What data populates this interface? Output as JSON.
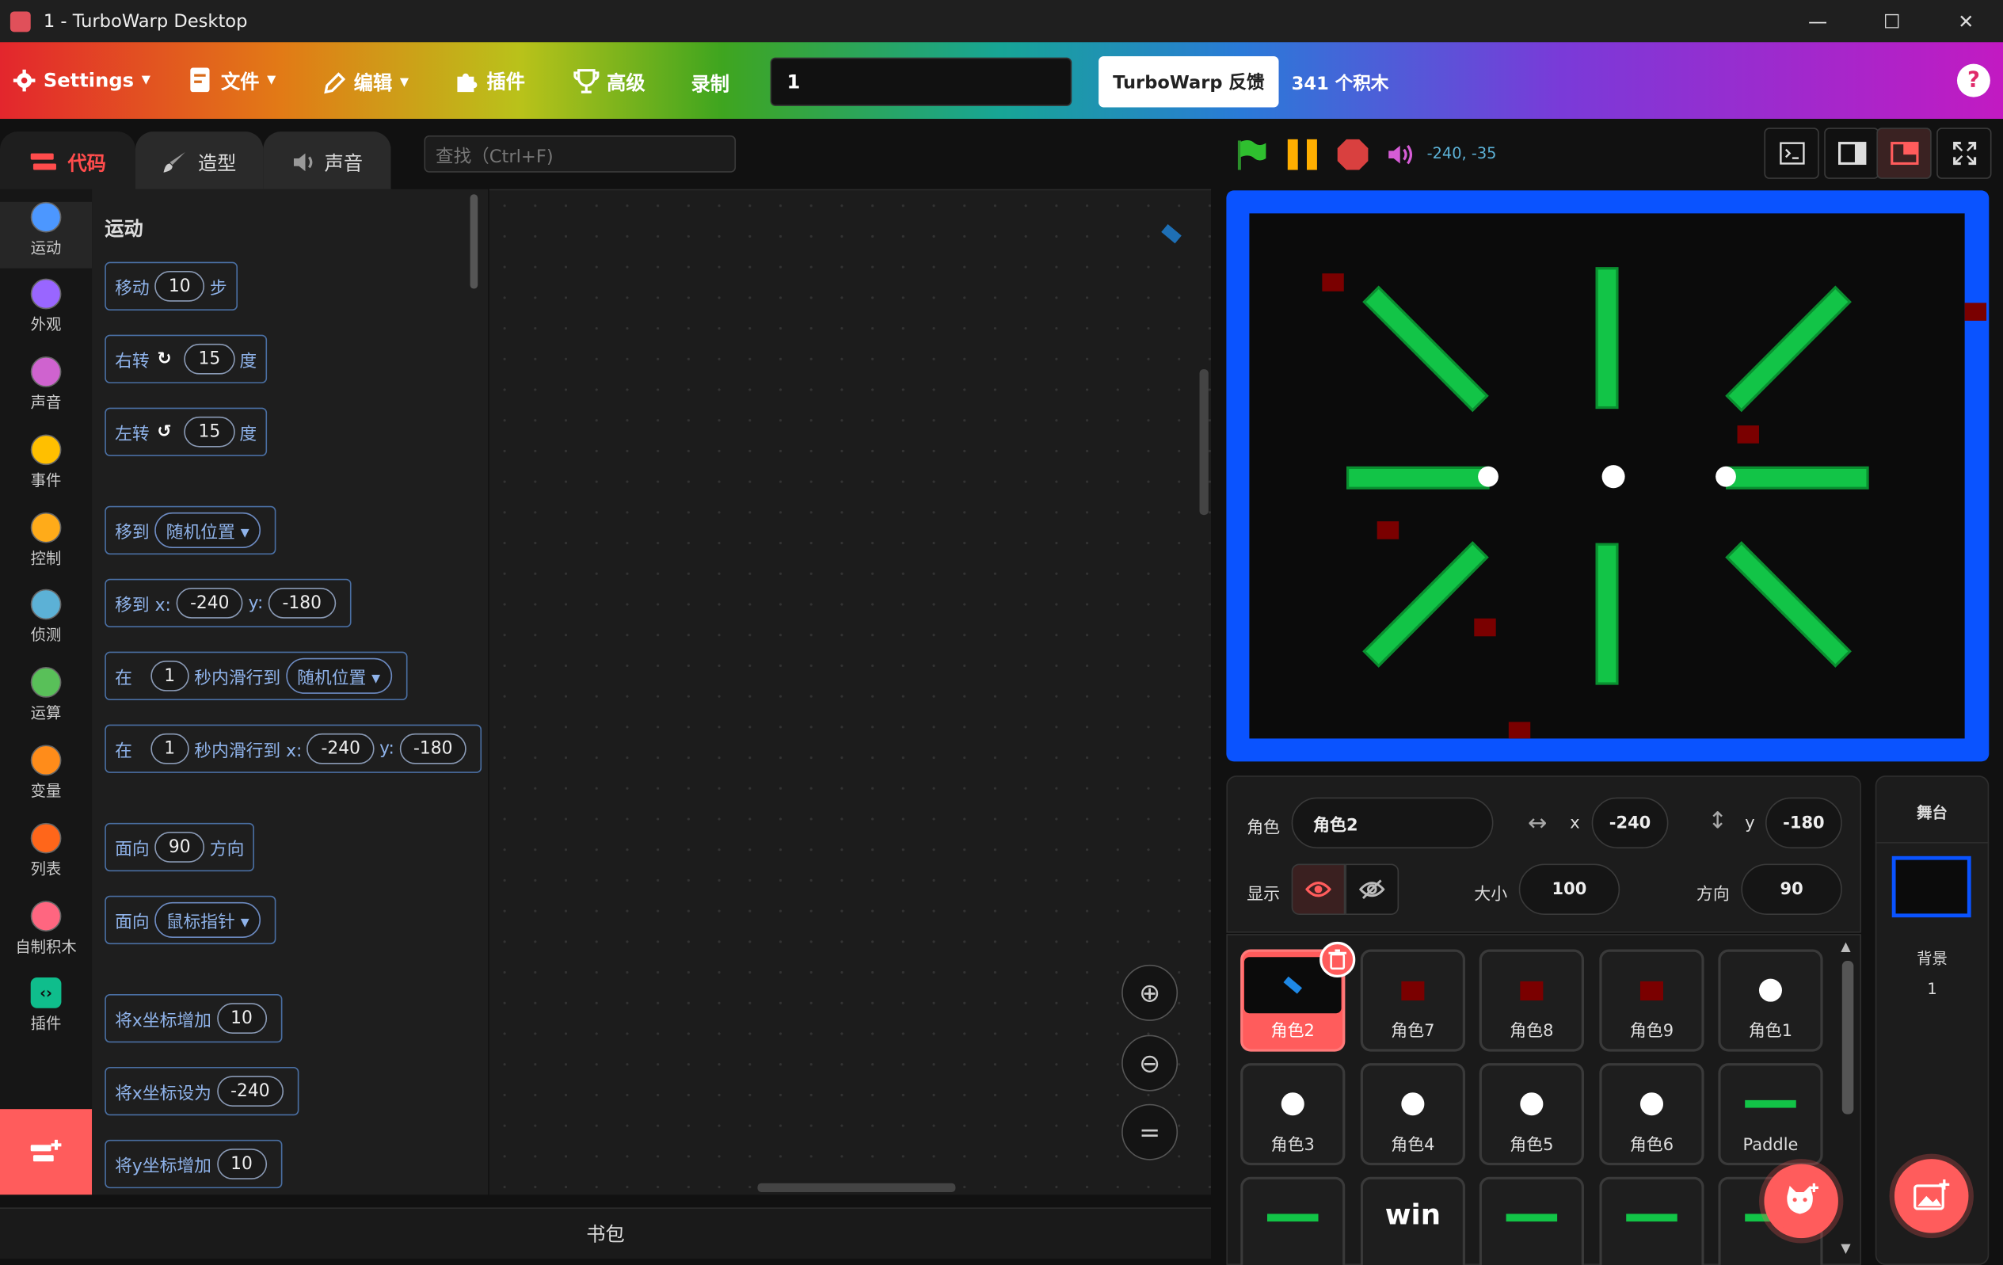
{
  "window": {
    "title": "1 - TurboWarp Desktop",
    "minimize": "—",
    "maximize": "☐",
    "close": "✕"
  },
  "menubar": {
    "settings": "Settings",
    "file": "文件",
    "edit": "编辑",
    "addons": "插件",
    "advanced": "高级",
    "record": "录制",
    "project_title": "1",
    "feedback": "TurboWarp 反馈",
    "block_count": "341 个积木",
    "help": "?"
  },
  "tabs": {
    "code": "代码",
    "costumes": "造型",
    "sounds": "声音"
  },
  "search": {
    "placeholder": "查找（Ctrl+F)"
  },
  "categories": [
    {
      "label": "运动",
      "color": "#4c97ff"
    },
    {
      "label": "外观",
      "color": "#9966ff"
    },
    {
      "label": "声音",
      "color": "#cf63cf"
    },
    {
      "label": "事件",
      "color": "#ffbf00"
    },
    {
      "label": "控制",
      "color": "#ffab19"
    },
    {
      "label": "侦测",
      "color": "#5cb1d6"
    },
    {
      "label": "运算",
      "color": "#59c059"
    },
    {
      "label": "变量",
      "color": "#ff8c1a"
    },
    {
      "label": "列表",
      "color": "#ff661a"
    },
    {
      "label": "自制积木",
      "color": "#ff6680"
    },
    {
      "label": "插件",
      "color": "#0fbd8c"
    }
  ],
  "palette": {
    "heading": "运动",
    "move": {
      "a": "移动",
      "v": "10",
      "b": "步"
    },
    "turn_right": {
      "a": "右转",
      "v": "15",
      "b": "度"
    },
    "turn_left": {
      "a": "左转",
      "v": "15",
      "b": "度"
    },
    "goto": {
      "a": "移到",
      "menu": "随机位置"
    },
    "goto_xy": {
      "a": "移到 x:",
      "x": "-240",
      "yl": "y:",
      "y": "-180"
    },
    "glide": {
      "a": "在",
      "v": "1",
      "b": "秒内滑行到",
      "menu": "随机位置"
    },
    "glide_xy": {
      "a": "在",
      "v": "1",
      "b": "秒内滑行到 x:",
      "x": "-240",
      "yl": "y:",
      "y": "-180"
    },
    "point_dir": {
      "a": "面向",
      "v": "90",
      "b": "方向"
    },
    "point_towards": {
      "a": "面向",
      "menu": "鼠标指针"
    },
    "change_x": {
      "a": "将x坐标增加",
      "v": "10"
    },
    "set_x": {
      "a": "将x坐标设为",
      "v": "-240"
    },
    "change_y": {
      "a": "将y坐标增加",
      "v": "10"
    }
  },
  "backpack": "书包",
  "stage_controls": {
    "coords": "-240, -35"
  },
  "sprite_info": {
    "sprite_label": "角色",
    "sprite_name": "角色2",
    "x_label": "x",
    "x": "-240",
    "y_label": "y",
    "y": "-180",
    "show_label": "显示",
    "size_label": "大小",
    "size": "100",
    "direction_label": "方向",
    "direction": "90"
  },
  "sprites": [
    "角色2",
    "角色7",
    "角色8",
    "角色9",
    "角色1",
    "角色3",
    "角色4",
    "角色5",
    "角色6",
    "Paddle",
    "",
    "win",
    "",
    "",
    ""
  ],
  "stage_panel": {
    "title": "舞台",
    "backdrops_label": "背景",
    "backdrops_count": "1"
  }
}
